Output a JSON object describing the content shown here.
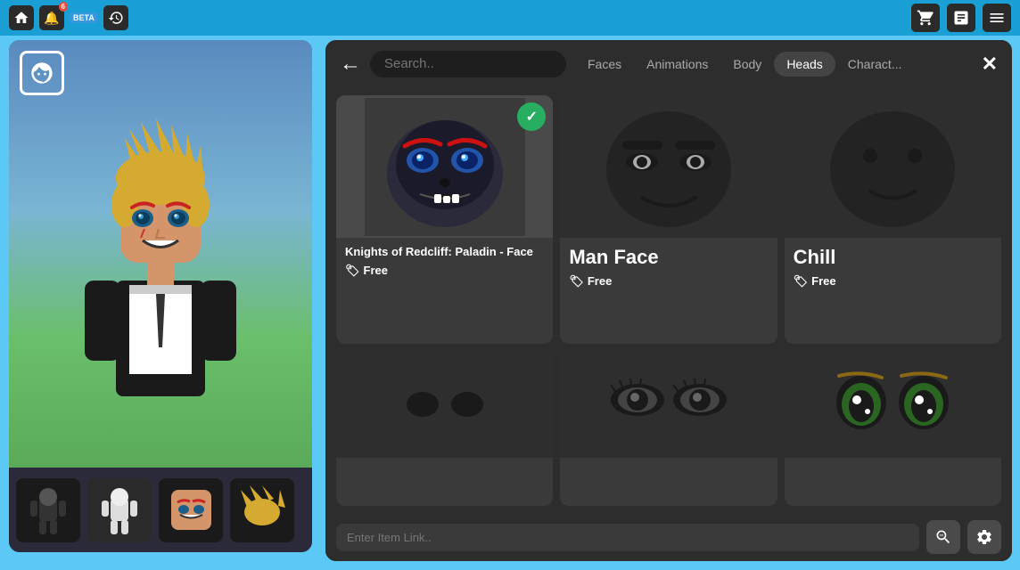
{
  "topbar": {
    "notifications": "6",
    "beta_label": "BETA"
  },
  "shop": {
    "search_placeholder": "Search..",
    "item_link_placeholder": "Enter Item Link..",
    "tabs": [
      {
        "id": "faces",
        "label": "Faces",
        "active": false,
        "partial": true
      },
      {
        "id": "animations",
        "label": "Animations",
        "active": false
      },
      {
        "id": "body",
        "label": "Body",
        "active": false
      },
      {
        "id": "heads",
        "label": "Heads",
        "active": true
      },
      {
        "id": "characters",
        "label": "Charact...",
        "active": false
      }
    ],
    "items": [
      {
        "id": "knights-face",
        "name": "Knights of Redcliff: Paladin - Face",
        "price_label": "Free",
        "selected": true,
        "type": "face1"
      },
      {
        "id": "man-face",
        "name": "Man Face",
        "price_label": "Free",
        "selected": false,
        "type": "face2"
      },
      {
        "id": "chill",
        "name": "Chill",
        "price_label": "Free",
        "selected": false,
        "type": "face3"
      },
      {
        "id": "noob-face",
        "name": "",
        "price_label": "",
        "selected": false,
        "type": "face4"
      },
      {
        "id": "eye-face",
        "name": "",
        "price_label": "",
        "selected": false,
        "type": "face5"
      },
      {
        "id": "anime-face",
        "name": "",
        "price_label": "",
        "selected": false,
        "type": "face6"
      }
    ],
    "close_label": "✕",
    "back_label": "←"
  },
  "thumbnails": [
    {
      "id": "thumb1",
      "type": "default-avatar"
    },
    {
      "id": "thumb2",
      "type": "white-avatar"
    },
    {
      "id": "thumb3",
      "type": "face-thumb"
    },
    {
      "id": "thumb4",
      "type": "hair-thumb"
    }
  ]
}
